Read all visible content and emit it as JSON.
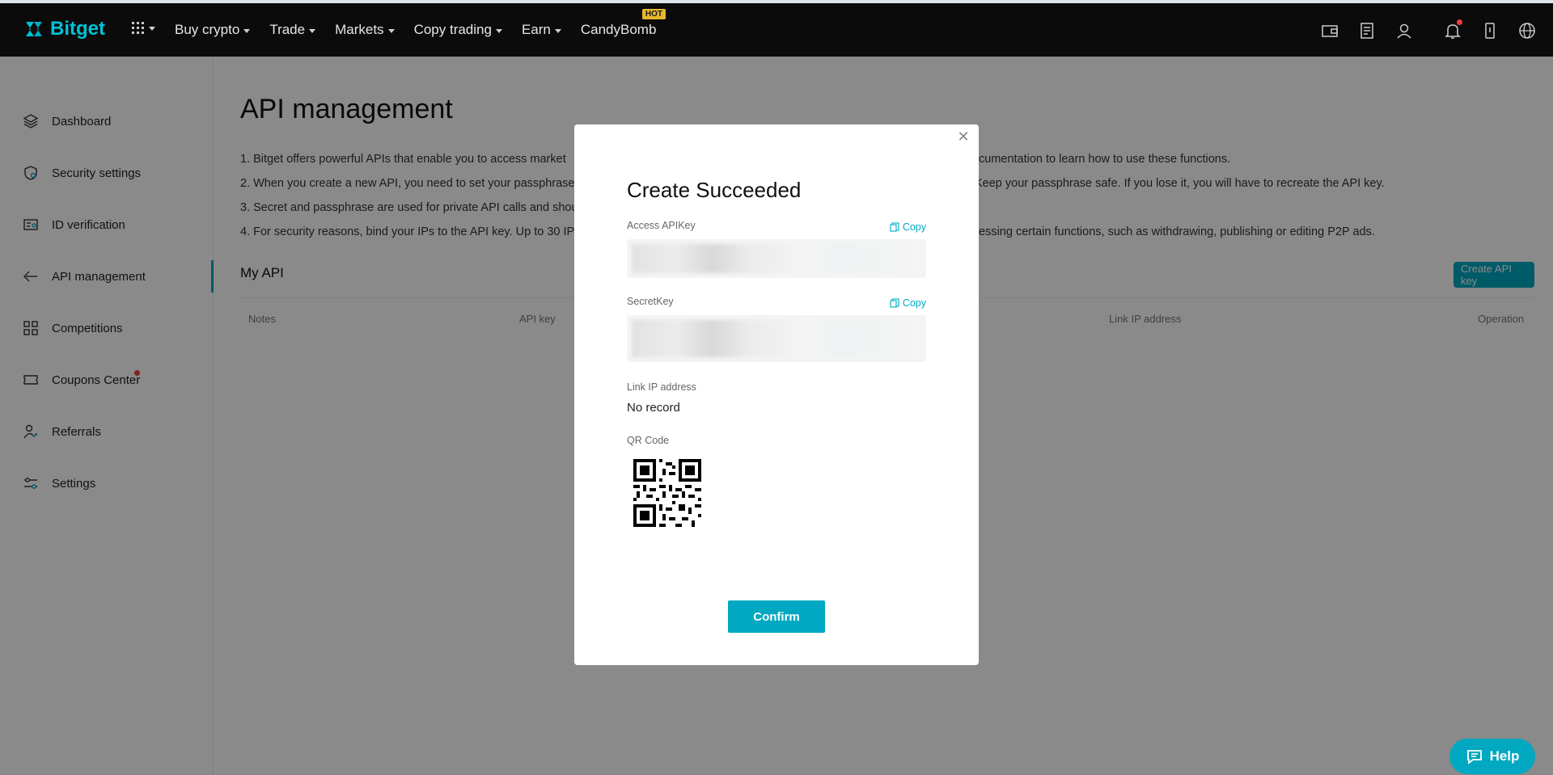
{
  "brand": {
    "name": "Bitget",
    "accent": "#00a9c1"
  },
  "nav": {
    "items": [
      {
        "label": "Buy crypto",
        "has_caret": true
      },
      {
        "label": "Trade",
        "has_caret": true
      },
      {
        "label": "Markets",
        "has_caret": true
      },
      {
        "label": "Copy trading",
        "has_caret": true
      },
      {
        "label": "Earn",
        "has_caret": true
      },
      {
        "label": "CandyBomb",
        "badge": "HOT"
      }
    ],
    "icons": [
      "wallet-icon",
      "orders-icon",
      "user-icon",
      "bell-icon",
      "download-icon",
      "globe-icon"
    ]
  },
  "sidebar": {
    "items": [
      {
        "label": "Dashboard",
        "icon": "layers-icon"
      },
      {
        "label": "Security settings",
        "icon": "shield-icon"
      },
      {
        "label": "ID verification",
        "icon": "id-card-icon"
      },
      {
        "label": "API management",
        "icon": "api-icon",
        "active": true
      },
      {
        "label": "Competitions",
        "icon": "grid-icon"
      },
      {
        "label": "Coupons Center",
        "icon": "ticket-icon",
        "dot": true
      },
      {
        "label": "Referrals",
        "icon": "referral-icon"
      },
      {
        "label": "Settings",
        "icon": "sliders-icon"
      }
    ]
  },
  "page": {
    "title": "API management",
    "notes": [
      "1. Bitget offers powerful APIs that enable you to access market",
      "2. When you create a new API, you need to set your passphrase",
      "3. Secret and passphrase are used for private API calls and shou",
      "4. For security reasons, bind your IPs to the API key. Up to 30 IP"
    ],
    "notes_right": [
      "cumentation to learn how to use these functions.",
      "Keep your passphrase safe. If you lose it, you will have to recreate the API key.",
      "",
      "essing certain functions, such as withdrawing, publishing or editing P2P ads."
    ],
    "my_api_title": "My API",
    "create_button": "Create API key",
    "table_headers": {
      "notes": "Notes",
      "api_key": "API key",
      "link_ip": "Link IP address",
      "operation": "Operation"
    }
  },
  "modal": {
    "title": "Create Succeeded",
    "access_label": "Access APIKey",
    "secret_label": "SecretKey",
    "copy_label": "Copy",
    "link_ip_label": "Link IP address",
    "link_ip_value": "No record",
    "qr_label": "QR Code",
    "confirm_label": "Confirm"
  },
  "help": {
    "label": "Help"
  }
}
